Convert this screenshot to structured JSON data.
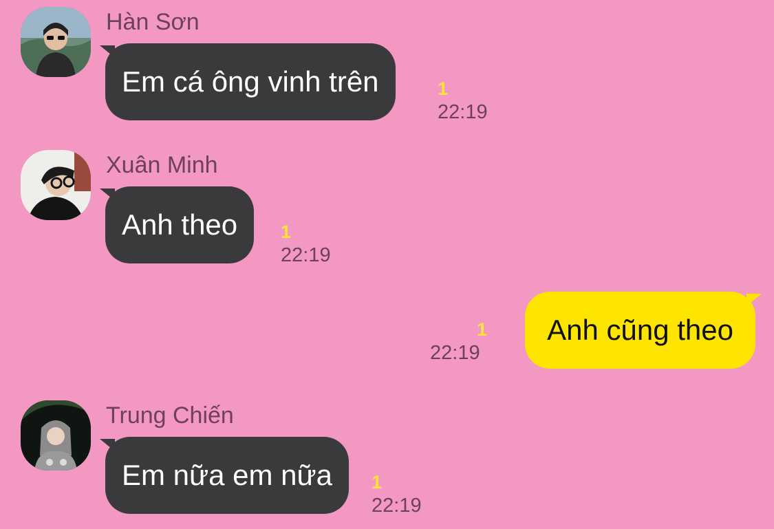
{
  "chat": {
    "messages": [
      {
        "sender": "Hàn Sơn",
        "text": "Em cá ông vinh trên",
        "unread": "1",
        "time": "22:19",
        "direction": "incoming",
        "avatar": "person-sunglasses-avatar"
      },
      {
        "sender": "Xuân Minh",
        "text": "Anh theo",
        "unread": "1",
        "time": "22:19",
        "direction": "incoming",
        "avatar": "person-glasses-avatar"
      },
      {
        "text": "Anh cũng theo",
        "unread": "1",
        "time": "22:19",
        "direction": "outgoing"
      },
      {
        "sender": "Trung Chiến",
        "text": "Em nữa em nữa",
        "unread": "1",
        "time": "22:19",
        "direction": "incoming",
        "avatar": "person-hood-avatar"
      }
    ]
  },
  "colors": {
    "background": "#f298c3",
    "incoming_bubble": "#3a3a3c",
    "outgoing_bubble": "#fee500",
    "unread_count": "#ffe33a",
    "meta_text": "#6e4159"
  }
}
